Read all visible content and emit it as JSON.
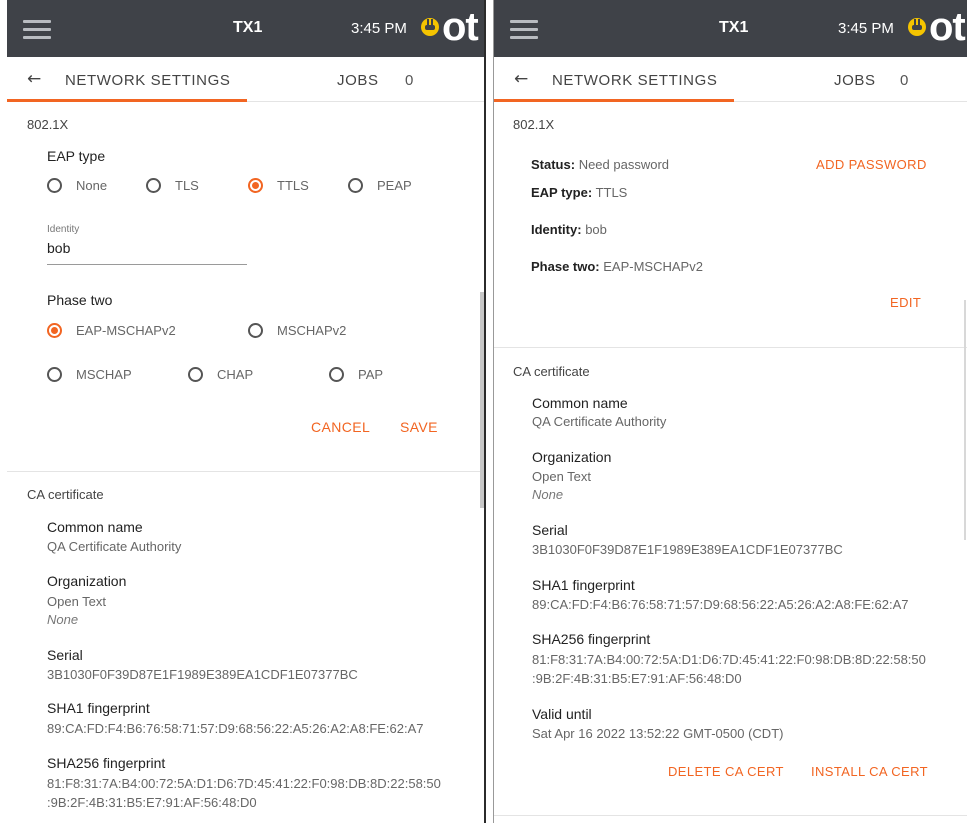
{
  "header": {
    "device": "TX1",
    "time": "3:45 PM",
    "logo": "ot"
  },
  "subheader": {
    "title": "NETWORK SETTINGS",
    "jobs_label": "JOBS",
    "jobs_count": "0"
  },
  "colors": {
    "accent": "#f26522",
    "topbar": "#3f4248"
  },
  "left": {
    "section_8021x": "802.1X",
    "eap_type_label": "EAP type",
    "eap_options": [
      "None",
      "TLS",
      "TTLS",
      "PEAP"
    ],
    "eap_selected": "TTLS",
    "identity_hint": "Identity",
    "identity_value": "bob",
    "phase_two_label": "Phase two",
    "phase_options": [
      "EAP-MSCHAPv2",
      "MSCHAPv2",
      "MSCHAP",
      "CHAP",
      "PAP"
    ],
    "phase_selected": "EAP-MSCHAPv2",
    "cancel_label": "CANCEL",
    "save_label": "SAVE"
  },
  "right": {
    "section_8021x": "802.1X",
    "status_label": "Status:",
    "status_value": "Need password",
    "add_password_label": "ADD PASSWORD",
    "eap_type_label": "EAP type:",
    "eap_type_value": "TTLS",
    "identity_label": "Identity:",
    "identity_value": "bob",
    "phase_two_label": "Phase two:",
    "phase_two_value": "EAP-MSCHAPv2",
    "edit_label": "EDIT"
  },
  "ca": {
    "section": "CA certificate",
    "common_name_label": "Common name",
    "common_name": "QA Certificate Authority",
    "organization_label": "Organization",
    "organization": "Open Text",
    "organization_unit": "None",
    "serial_label": "Serial",
    "serial": "3B1030F0F39D87E1F1989E389EA1CDF1E07377BC",
    "sha1_label": "SHA1 fingerprint",
    "sha1": "89:CA:FD:F4:B6:76:58:71:57:D9:68:56:22:A5:26:A2:A8:FE:62:A7",
    "sha256_label": "SHA256 fingerprint",
    "sha256_line1": "81:F8:31:7A:B4:00:72:5A:D1:D6:7D:45:41:22:F0:98:DB:8D:22:58:50",
    "sha256_line2": ":9B:2F:4B:31:B5:E7:91:AF:56:48:D0",
    "valid_until_label": "Valid until",
    "valid_until": "Sat Apr 16 2022 13:52:22 GMT-0500 (CDT)",
    "delete_label": "DELETE CA CERT",
    "install_label": "INSTALL CA CERT"
  }
}
